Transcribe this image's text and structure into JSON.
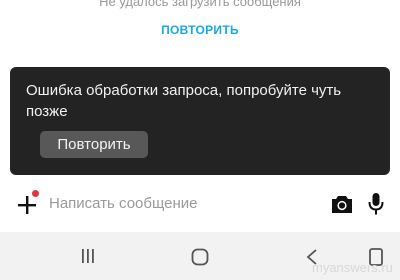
{
  "feed": {
    "load_error_text": "Не удалось загрузить сообщения",
    "retry_link_label": "ПОВТОРИТЬ"
  },
  "snackbar": {
    "message": "Ошибка обработки запроса, попробуйте чуть позже",
    "button_label": "Повторить"
  },
  "composer": {
    "placeholder": "Написать сообщение",
    "icons": [
      "plus-icon",
      "notification-dot",
      "camera-icon",
      "microphone-icon"
    ]
  },
  "navbar": {
    "icons": [
      "recent-apps-icon",
      "home-icon",
      "back-icon",
      "overview-icon"
    ]
  },
  "watermark": "myanswers.ru",
  "colors": {
    "accent": "#19a7e0",
    "snackbar_bg": "#232323",
    "snackbar_button_bg": "#585858",
    "notification_dot": "#e0353b"
  }
}
